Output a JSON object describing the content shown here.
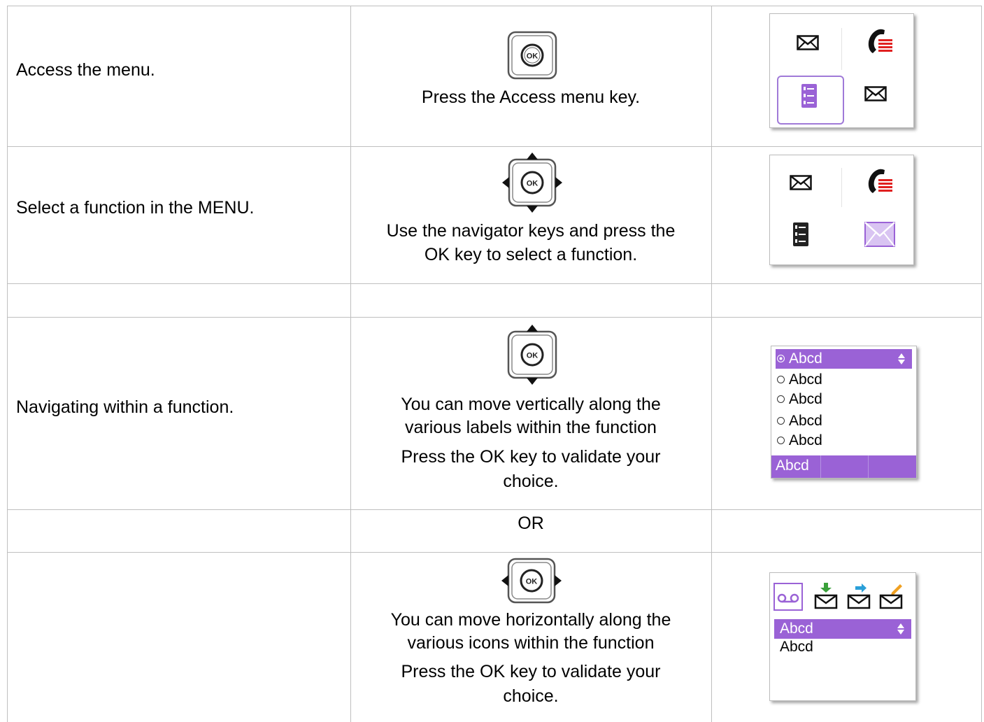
{
  "rows": {
    "r1": {
      "action": "Access the menu.",
      "instruction": "Press the Access menu key.",
      "key_icon": "ok-key-icon"
    },
    "r2": {
      "action": "Select a function in the MENU.",
      "instruction_line1": "Use the navigator keys and press the",
      "instruction_line2": "OK key to select a function.",
      "key_icon": "navigator-4way-key-icon"
    },
    "r4": {
      "action": "Navigating within a function.",
      "instruction_line1": "You can move vertically along the",
      "instruction_line2": "various labels within the function",
      "validate_line1": "Press the OK key to validate your",
      "validate_line2": "choice.",
      "key_icon": "navigator-updown-key-icon",
      "screen": {
        "selected_item": "Abcd",
        "items": [
          "Abcd",
          "Abcd",
          "Abcd",
          "Abcd"
        ],
        "softkey": "Abcd"
      }
    },
    "r5": {
      "text": "OR"
    },
    "r6": {
      "instruction_line1": "You can move horizontally along the",
      "instruction_line2": "various icons within the function",
      "validate_line1": "Press the OK key to validate your",
      "validate_line2": "choice.",
      "key_icon": "navigator-leftright-key-icon",
      "screen": {
        "icons": [
          "voicemail-icon",
          "mail-download-icon",
          "mail-forward-icon",
          "mail-compose-icon"
        ],
        "selected_item": "Abcd",
        "items": [
          "Abcd"
        ]
      }
    }
  },
  "colors": {
    "accent_purple": "#9a62d6",
    "call_red": "#e02020",
    "grid": "#bfbfbf"
  }
}
